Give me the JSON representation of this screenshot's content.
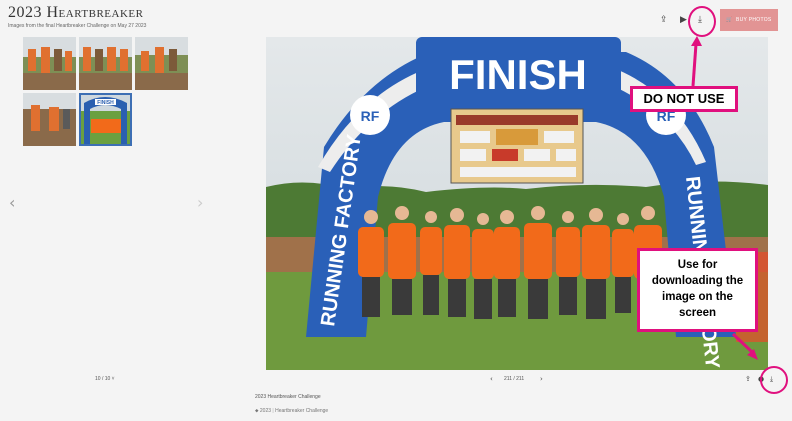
{
  "gallery": {
    "title": "2023 Heartbreaker",
    "subtitle": "Images from the final Heartbreaker Challenge on May 27 2023"
  },
  "thumbnails": {
    "counter": "10 / 10 ˅"
  },
  "toolbar": {
    "share_icon": "share-icon",
    "play_icon": "play-icon",
    "download_icon": "download-icon",
    "buy_label": "BUY PHOTOS"
  },
  "annotations": {
    "do_not_use": "DO NOT USE",
    "use_for_download": "Use for downloading the image on the screen",
    "accent_color": "#e0107e"
  },
  "photo": {
    "banner_text": "FINISH",
    "arch_text_left": "RUNNING FACTORY",
    "arch_text_right": "RUNNING FACTORY",
    "logo": "RF"
  },
  "viewer": {
    "pager": "211 / 211",
    "caption": "2023 Heartbreaker Challenge",
    "tag_year": "2023",
    "tag_event": "Heartbreaker Challenge"
  }
}
